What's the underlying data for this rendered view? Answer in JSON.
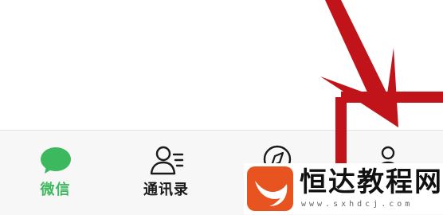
{
  "tabbar": {
    "tabs": [
      {
        "label": "微信",
        "icon": "chat-bubble-icon",
        "active": true
      },
      {
        "label": "通讯录",
        "icon": "contacts-icon",
        "active": false
      },
      {
        "label": "",
        "icon": "compass-icon",
        "active": false
      },
      {
        "label": "",
        "icon": "person-icon",
        "active": false
      }
    ]
  },
  "colors": {
    "active": "#3cb95e",
    "inactive": "#1a1a1a",
    "tabbar_bg": "#f7f7f7",
    "annotation": "#c0141a",
    "watermark_logo": "#e8541f"
  },
  "watermark": {
    "title": "恒达教程网",
    "url": "www.sxhdcj.com"
  }
}
